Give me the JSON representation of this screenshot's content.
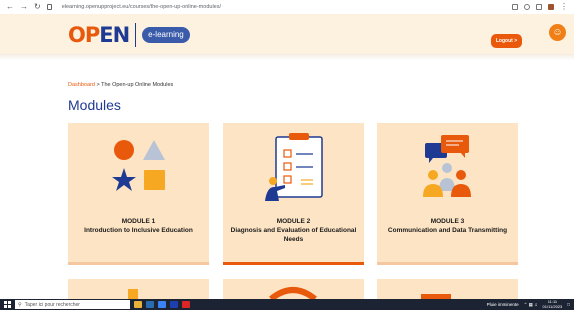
{
  "browser": {
    "url": "elearning.openupproject.eu/courses/the-open-up-online-modules/",
    "back_icon": "arrow-left-icon",
    "forward_icon": "arrow-right-icon",
    "reload_icon": "reload-icon"
  },
  "header": {
    "logo_text_a": "OP",
    "logo_text_b": "EN",
    "elearning_label": "e-learning",
    "logout_label": "Logout >",
    "accessibility_icon": "accessibility-icon"
  },
  "breadcrumb": {
    "root": "Dashboard",
    "separator": " > ",
    "current": "The Open-up Online Modules"
  },
  "page_title": "Modules",
  "modules": [
    {
      "number": "MODULE 1",
      "title": "Introduction to Inclusive Education"
    },
    {
      "number": "MODULE 2",
      "title": "Diagnosis and Evaluation of Educational Needs"
    },
    {
      "number": "MODULE 3",
      "title": "Communication and Data Transmitting"
    }
  ],
  "taskbar": {
    "search_placeholder": "Taper ici pour rechercher",
    "weather": "Pluie imminente",
    "time": "11:11",
    "date": "01/11/2023"
  },
  "colors": {
    "accent": "#e8590c",
    "brand_blue": "#1f3a93",
    "card_bg": "#fde4c4"
  }
}
